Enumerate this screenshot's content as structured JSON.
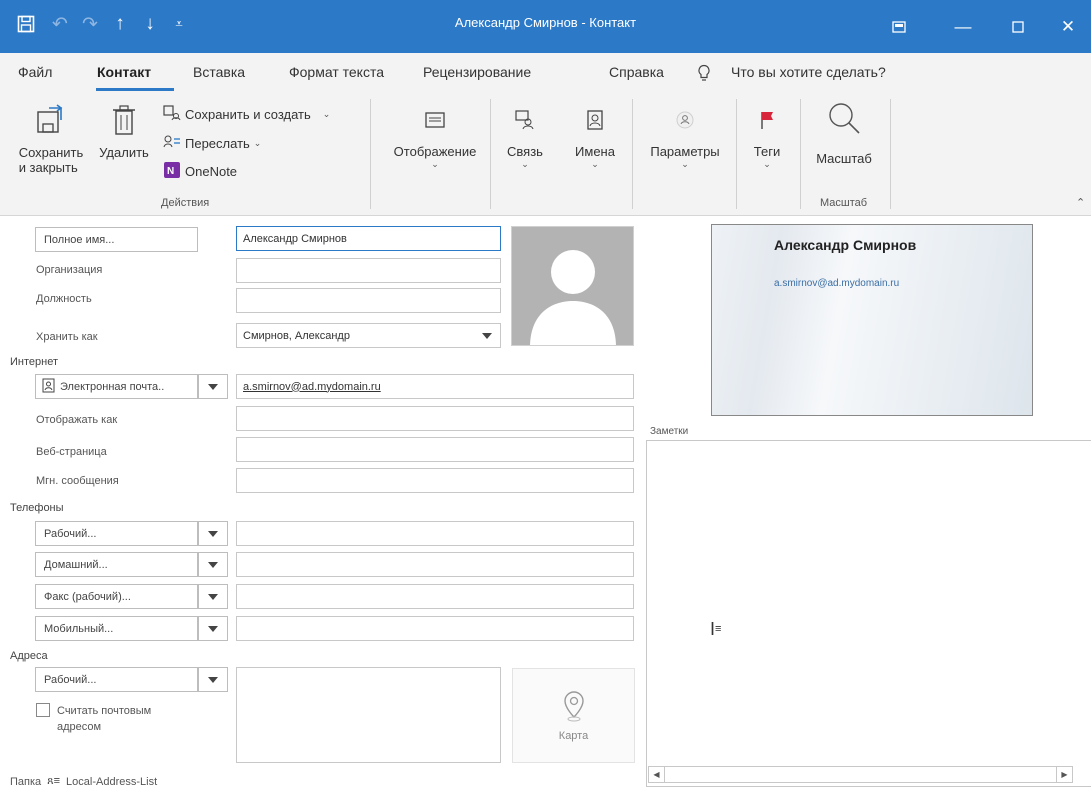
{
  "window": {
    "title": "Александр Смирнов  -  Контакт",
    "quick_access": [
      "save-icon",
      "undo-icon",
      "redo-icon",
      "up-arrow-icon",
      "down-arrow-icon",
      "customize-icon"
    ],
    "accent": "#2b79c7"
  },
  "menu": {
    "items": [
      "Файл",
      "Контакт",
      "Вставка",
      "Формат текста",
      "Рецензирование",
      "Справка"
    ],
    "active": "Контакт",
    "tell_me": "Что вы хотите сделать?"
  },
  "ribbon": {
    "save_close": "Сохранить\nи закрыть",
    "delete": "Удалить",
    "save_new": "Сохранить и создать",
    "forward": "Переслать",
    "onenote": "OneNote",
    "group_actions": "Действия",
    "show": "Отображение",
    "communicate": "Связь",
    "names": "Имена",
    "options": "Параметры",
    "tags": "Теги",
    "zoom": "Масштаб",
    "group_zoom": "Масштаб"
  },
  "form": {
    "full_name_btn": "Полное имя...",
    "full_name": "Александр Смирнов",
    "company_label": "Организация",
    "company": "",
    "job_label": "Должность",
    "job": "",
    "file_as_label": "Хранить как",
    "file_as": "Смирнов, Александр",
    "internet_section": "Интернет",
    "email_btn": "Электронная почта..",
    "email": "a.smirnov@ad.mydomain.ru",
    "display_as_label": "Отображать как",
    "display_as": "",
    "web_label": "Веб-страница",
    "web": "",
    "im_label": "Мгн. сообщения",
    "im": "",
    "phones_section": "Телефоны",
    "phones": [
      {
        "label": "Рабочий...",
        "value": ""
      },
      {
        "label": "Домашний...",
        "value": ""
      },
      {
        "label": "Факс (рабочий)...",
        "value": ""
      },
      {
        "label": "Мобильный...",
        "value": ""
      }
    ],
    "address_section": "Адреса",
    "address_type": "Рабочий...",
    "address_value": "",
    "mailing_checkbox": "Считать почтовым\nадресом",
    "map": "Карта",
    "folder_label": "Папка",
    "folder": "Local-Address-List"
  },
  "card": {
    "name": "Александр Смирнов",
    "email": "a.smirnov@ad.mydomain.ru"
  },
  "notes": {
    "label": "Заметки"
  }
}
